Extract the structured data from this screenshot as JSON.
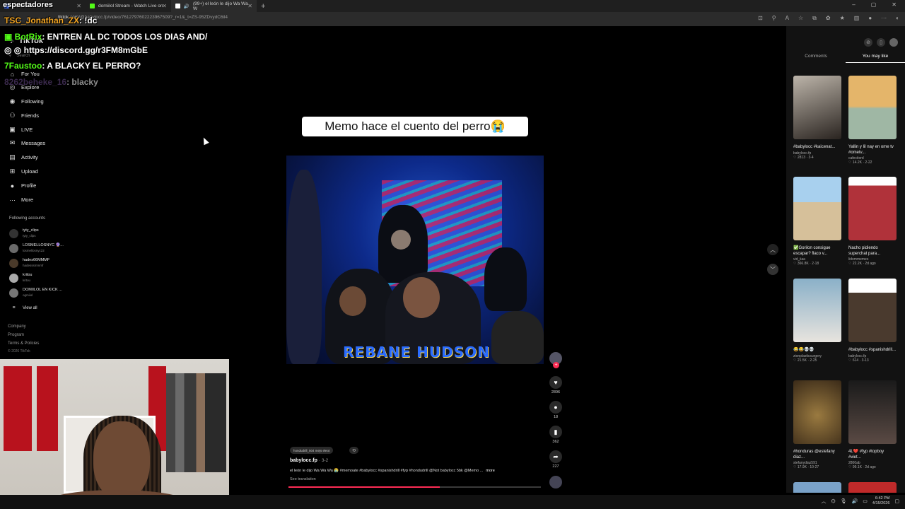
{
  "browser": {
    "tabs": [
      {
        "title": "Dashboard",
        "favicon_color": "#3c6cff"
      },
      {
        "title": "domiilol Stream - Watch Live on",
        "favicon_color": "#53fc18"
      },
      {
        "title": "(99+) el león le dijo Wa Wa W",
        "favicon_color": "#ffffff"
      }
    ],
    "new_tab": "+",
    "url_prefix": "tiktok.com",
    "url_rest": "/@babylocc.fp/video/7612797602223967509?_r=1&_t=ZS-95ZDvydC6il4",
    "window_controls": [
      "–",
      "▢",
      "✕"
    ]
  },
  "sidebar": {
    "logo": "TikTok",
    "search_placeholder": "Search",
    "nav": [
      {
        "label": "For You",
        "icon": "home-icon",
        "glyph": "⌂"
      },
      {
        "label": "Explore",
        "icon": "compass-icon",
        "glyph": "◎"
      },
      {
        "label": "Following",
        "icon": "following-icon",
        "glyph": "◉"
      },
      {
        "label": "Friends",
        "icon": "friends-icon",
        "glyph": "⚇"
      },
      {
        "label": "LIVE",
        "icon": "live-icon",
        "glyph": "▣"
      },
      {
        "label": "Messages",
        "icon": "messages-icon",
        "glyph": "✉"
      },
      {
        "label": "Activity",
        "icon": "activity-icon",
        "glyph": "▤"
      },
      {
        "label": "Upload",
        "icon": "upload-icon",
        "glyph": "⊞"
      },
      {
        "label": "Profile",
        "icon": "avatar-icon",
        "glyph": "●"
      },
      {
        "label": "More",
        "icon": "more-icon",
        "glyph": "···"
      }
    ],
    "following_title": "Following accounts",
    "accounts": [
      {
        "name": "tyty_clips",
        "handle": "tyty_clips"
      },
      {
        "name": "LOSMELLOSNYC 🔮...",
        "handle": "losmellosnyc22"
      },
      {
        "name": "hades66MMMF",
        "handle": "hadesssmmmf"
      },
      {
        "name": "kritou",
        "handle": "kritou"
      },
      {
        "name": "DOMIILOL EN KICK ...",
        "handle": "ogmiiol"
      }
    ],
    "view_all": "View all",
    "footer": [
      "Company",
      "Program",
      "Terms & Policies",
      "© 2026 TikTok"
    ]
  },
  "chat": [
    {
      "user": "espectadores",
      "text": "",
      "color": "#ffffff"
    },
    {
      "user": "TSC_Jonathan_ZX",
      "text": ": !dc",
      "color": "#f5a623"
    },
    {
      "user": "BotRix",
      "text": ": ENTREN AL DC TODOS LOS DIAS AND/",
      "color": "#53fc18"
    },
    {
      "user": "",
      "text": "https://discord.gg/r3FM8mGbE",
      "color": "#ffffff"
    },
    {
      "user": "7Faustoo",
      "text": ": A BLACKY EL PERRO?",
      "color": "#53fc18"
    },
    {
      "user": "8262beheke_16",
      "text": ": blacky",
      "color": "#6a4c8a"
    }
  ],
  "video": {
    "caption": "Memo hace el cuento del perro😭",
    "overlay_title": "REBANE HUDSON",
    "progress_fraction": 0.6
  },
  "actions": [
    {
      "icon": "like-icon",
      "glyph": "♥",
      "count": "2896"
    },
    {
      "icon": "comment-icon",
      "glyph": "●",
      "count": "18"
    },
    {
      "icon": "bookmark-icon",
      "glyph": "▮",
      "count": "362"
    },
    {
      "icon": "share-icon",
      "glyph": "➦",
      "count": "227"
    }
  ],
  "post": {
    "tag_pill": "hondudrill_504 mejs eleot",
    "author": "babylocc.fp",
    "date": "· 3-2",
    "description": "el león le dijo Wa Wa Wa 😭 #memoate #babylocc #spanishdrill #fyp #hondudrill @Not babylocc 5bk @Memo ...",
    "more": "more",
    "see_translation": "See translation"
  },
  "right_panel": {
    "tabs": [
      "Comments",
      "You may like"
    ],
    "active_tab": 1,
    "cards": [
      {
        "title": "#babylocc #kaicenat...",
        "author": "babylocc.fp",
        "stats": "♡ 2813 · 3-4",
        "color": "#9a8f86"
      },
      {
        "title": "Yallin y lil nay en ome tv #ometv...",
        "author": "cafecitord",
        "stats": "♡ 14.2K · 2-22",
        "color": "#d8a65a"
      },
      {
        "title": "✅Gorilon consigue escapar? flaco v...",
        "author": "vid_iiaa",
        "stats": "♡ 366.8K · 2-18",
        "color": "#9ec6e6"
      },
      {
        "title": "Nacho pidiendo superchat para...",
        "author": "lidommemes",
        "stats": "♡ 22.2K · 2d ago",
        "color": "#b0323a"
      },
      {
        "title": "😂😂💀💀",
        "author": "zionplasticsurgery",
        "stats": "♡ 21.5K · 2-25",
        "color": "#8aa0b2"
      },
      {
        "title": "#babylocc #spanishdrill...",
        "author": "babylocc.fp",
        "stats": "♡ 614 · 3-13",
        "color": "#4a3a2e"
      },
      {
        "title": "#honduras @estefany diaz...",
        "author": "stefanydiaz591",
        "stats": "♡ 17.9K · 10-27",
        "color": "#6a5230"
      },
      {
        "title": "4L❤️ #fyp #topboy #viet...",
        "author": "2800ab",
        "stats": "♡ 99.1K · 2d ago",
        "color": "#2a2a2a"
      }
    ]
  },
  "taskbar": {
    "time": "6:42 PM",
    "date": "4/15/2026"
  }
}
